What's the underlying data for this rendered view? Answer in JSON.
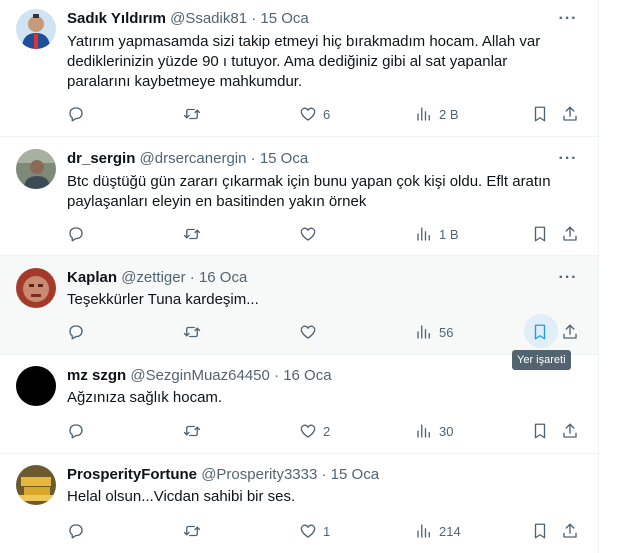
{
  "tweets": [
    {
      "name": "Sadık Yıldırım",
      "handle": "@Ssadik81",
      "date": "15 Oca",
      "text": "Yatırım yapmasamda sizi takip etmeyi hiç bırakmadım hocam. Allah var dediklerinizin yüzde 90 ı tutuyor. Ama dediğiniz gibi al sat yapanlar paralarını kaybetmeye mahkumdur.",
      "likes": "6",
      "views": "2 B"
    },
    {
      "name": "dr_sergin",
      "handle": "@drsercanergin",
      "date": "15 Oca",
      "text": "Btc düştüğü gün zararı çıkarmak için bunu yapan çok kişi oldu. Eflt aratın paylaşanları eleyin en basitinden yakın örnek",
      "likes": "",
      "views": "1 B"
    },
    {
      "name": "Kaplan",
      "handle": "@zettiger",
      "date": "16 Oca",
      "text": "Teşekkürler Tuna kardeşim...",
      "likes": "",
      "views": "56"
    },
    {
      "name": "mz szgn",
      "handle": "@SezginMuaz64450",
      "date": "16 Oca",
      "text": "Ağzınıza sağlık hocam.",
      "likes": "2",
      "views": "30"
    },
    {
      "name": "ProsperityFortune",
      "handle": "@Prosperity3333",
      "date": "15 Oca",
      "text": "Helal olsun...Vicdan sahibi bir ses.",
      "likes": "1",
      "views": "214"
    }
  ],
  "separator": "·",
  "more_glyph": "···",
  "tooltip": "Yer işareti",
  "colors": {
    "accent": "#1d9bf0",
    "muted": "#536471",
    "hover_bg": "#f7f9f9"
  },
  "icons": [
    "reply-icon",
    "retweet-icon",
    "like-icon",
    "views-icon",
    "bookmark-icon",
    "share-icon",
    "more-icon"
  ]
}
